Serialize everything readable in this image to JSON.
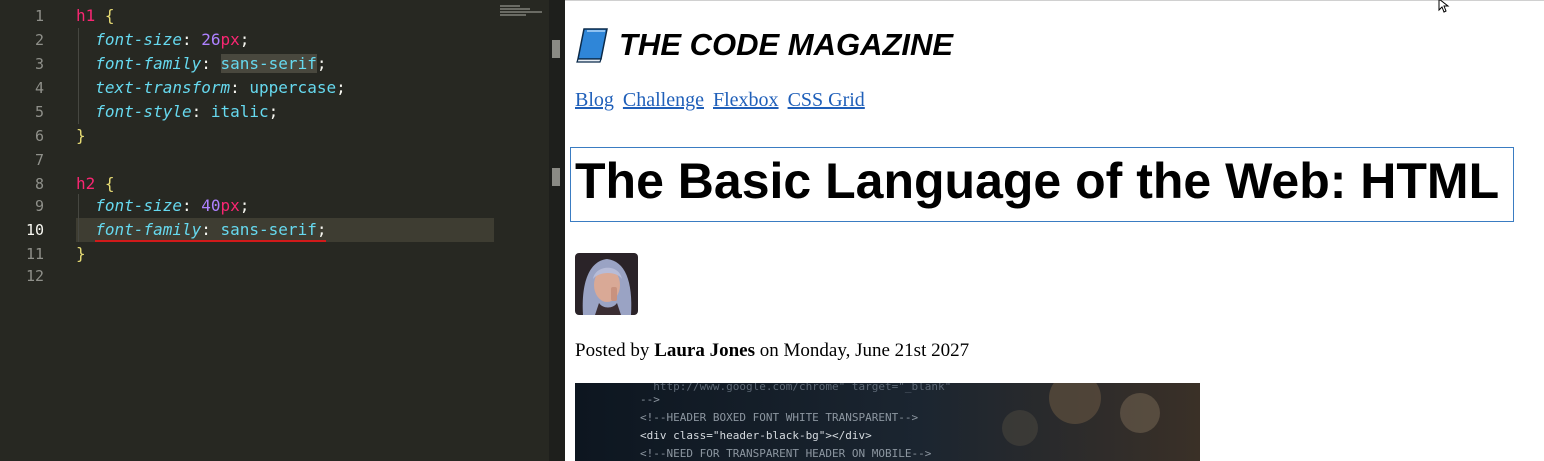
{
  "editor": {
    "lines": [
      {
        "num": "1"
      },
      {
        "num": "2"
      },
      {
        "num": "3"
      },
      {
        "num": "4"
      },
      {
        "num": "5"
      },
      {
        "num": "6"
      },
      {
        "num": "7"
      },
      {
        "num": "8"
      },
      {
        "num": "9"
      },
      {
        "num": "10"
      },
      {
        "num": "11"
      },
      {
        "num": "12"
      }
    ],
    "tokens": {
      "h1": "h1",
      "h2": "h2",
      "open_brace": "{",
      "close_brace": "}",
      "font_size": "font-size",
      "font_family": "font-family",
      "text_transform": "text-transform",
      "font_style": "font-style",
      "colon": ": ",
      "semi": ";",
      "v26": "26",
      "v40": "40",
      "px": "px",
      "sans_serif": "sans-serif",
      "uppercase": "uppercase",
      "italic": "italic"
    },
    "current_line": 10
  },
  "preview": {
    "magazine_title": "THE CODE MAGAZINE",
    "nav": [
      "Blog",
      "Challenge",
      "Flexbox",
      "CSS Grid"
    ],
    "heading": "The Basic Language of the Web: HTML",
    "posted_prefix": "Posted by ",
    "author": "Laura Jones",
    "posted_suffix": " on Monday, June 21st 2027",
    "hero_code": [
      "  http://www.google.com/chrome\" target=\"_blank\"",
      "-->",
      "<!--HEADER BOXED FONT WHITE TRANSPARENT-->",
      "<div class=\"header-black-bg\"></div>",
      "<!--NEED FOR TRANSPARENT HEADER ON MOBILE-->"
    ]
  },
  "colors": {
    "editor_bg": "#272822",
    "keyword": "#f92672",
    "property": "#66d9ef",
    "number": "#ae81ff",
    "brace": "#e6db74",
    "link": "#1f5fb9",
    "heading_border": "#3a7cc2"
  },
  "icons": {
    "book": "blue-book-icon",
    "cursor": "mouse-pointer-icon"
  }
}
